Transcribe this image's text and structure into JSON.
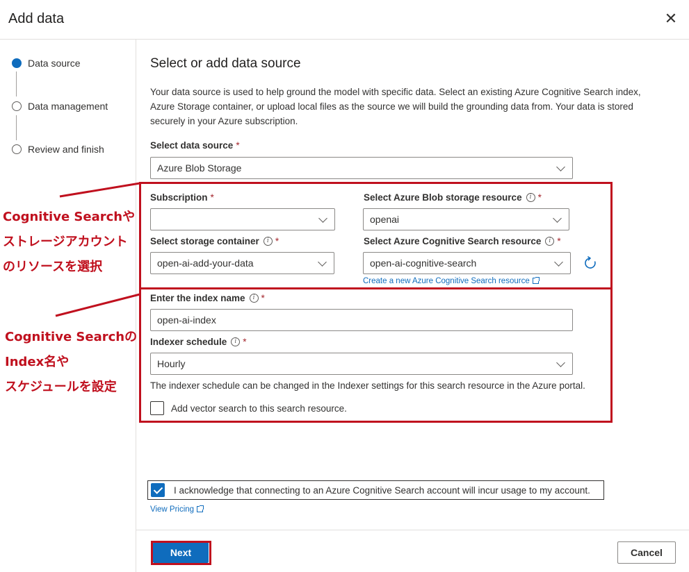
{
  "dialog": {
    "title": "Add data",
    "close_glyph": "✕"
  },
  "steps": [
    {
      "label": "Data source",
      "active": true
    },
    {
      "label": "Data management",
      "active": false
    },
    {
      "label": "Review and finish",
      "active": false
    }
  ],
  "main": {
    "heading": "Select or add data source",
    "description": "Your data source is used to help ground the model with specific data. Select an existing Azure Cognitive Search index, Azure Storage container, or upload local files as the source we will build the grounding data from. Your data is stored securely in your Azure subscription."
  },
  "fields": {
    "data_source": {
      "label": "Select data source",
      "required": "*",
      "value": "Azure Blob Storage"
    },
    "subscription": {
      "label": "Subscription",
      "required": "*",
      "value": ""
    },
    "blob_resource": {
      "label": "Select Azure Blob storage resource",
      "required": "*",
      "value": "openai"
    },
    "storage_container": {
      "label": "Select storage container",
      "required": "*",
      "value": "open-ai-add-your-data"
    },
    "search_resource": {
      "label": "Select Azure Cognitive Search resource",
      "required": "*",
      "value": "open-ai-cognitive-search"
    },
    "index_name": {
      "label": "Enter the index name",
      "required": "*",
      "value": "open-ai-index"
    },
    "indexer_schedule": {
      "label": "Indexer schedule",
      "required": "*",
      "value": "Hourly"
    }
  },
  "links": {
    "create_search": "Create a new Azure Cognitive Search resource",
    "view_pricing": "View Pricing"
  },
  "indexer_hint": "The indexer schedule can be changed in the Indexer settings for this search resource in the Azure portal.",
  "vector_search": {
    "label": "Add vector search to this search resource.",
    "checked": false
  },
  "acknowledge": {
    "label": "I acknowledge that connecting to an Azure Cognitive Search account will incur usage to my account.",
    "checked": true
  },
  "buttons": {
    "next": "Next",
    "cancel": "Cancel"
  },
  "annotations": {
    "resource_note": [
      "Cognitive Searchや",
      "ストレージアカウント",
      "のリソースを選択"
    ],
    "index_note": [
      "Cognitive Searchの",
      "Index名や",
      "スケジュールを設定"
    ],
    "color": "#c0101e"
  },
  "colors": {
    "accent": "#0f6cbd",
    "required": "#a4262c"
  }
}
